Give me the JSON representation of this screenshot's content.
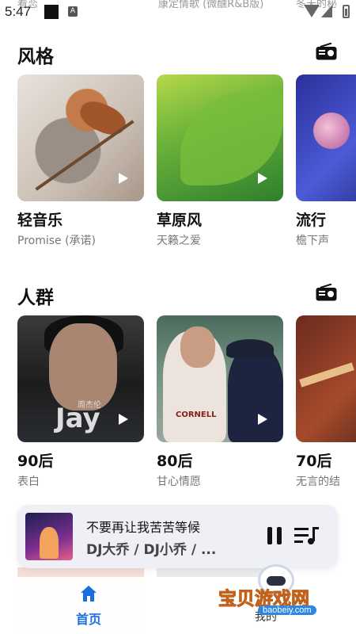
{
  "status_bar": {
    "time": "5:47",
    "ghost_left": "看恋",
    "ghost_mid": "康定情歌 (微醺R&B版)",
    "ghost_right": "冬天的秘"
  },
  "sections": [
    {
      "title": "风格",
      "icon": "radio-icon",
      "cards": [
        {
          "name": "轻音乐",
          "sub": "Promise (承诺)"
        },
        {
          "name": "草原风",
          "sub": "天籁之爱"
        },
        {
          "name": "流行",
          "sub": "檐下声"
        }
      ]
    },
    {
      "title": "人群",
      "icon": "radio-icon",
      "cards": [
        {
          "name": "90后",
          "sub": "表白",
          "cover_text": "Jay",
          "cover_text_cn": "周杰伦"
        },
        {
          "name": "80后",
          "sub": "甘心情愿",
          "cover_text": "CORNELL"
        },
        {
          "name": "70后",
          "sub": "无言的结"
        }
      ]
    }
  ],
  "player": {
    "song": "不要再让我苦苦等候",
    "artist": "DJ大乔 / DJ小乔 / ...",
    "pause_icon": "pause-icon",
    "queue_icon": "playlist-icon"
  },
  "bottom_nav": {
    "home_label": "首页",
    "other_label": "我的"
  },
  "watermark": {
    "title": "宝贝游戏网",
    "url": "baobeiy.com"
  },
  "colors": {
    "accent": "#1a6fe0",
    "player_bg": "#eef0f6"
  }
}
